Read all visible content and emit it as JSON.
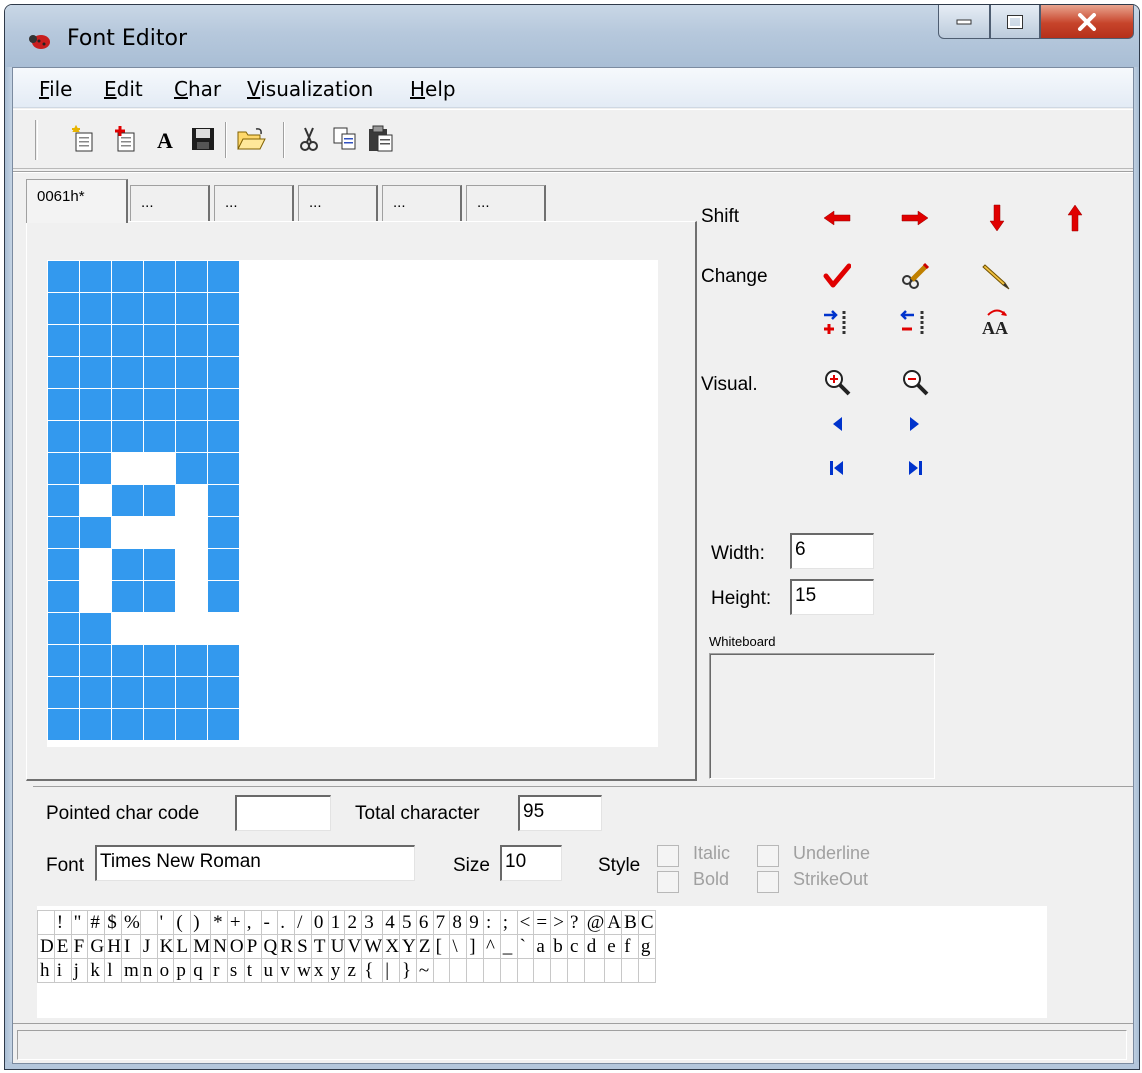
{
  "window": {
    "title": "Font Editor"
  },
  "menu": [
    "File",
    "Edit",
    "Char",
    "Visualization",
    "Help"
  ],
  "menu_underline": [
    "F",
    "E",
    "C",
    "V",
    "H"
  ],
  "toolbar": {
    "icons": [
      "new-font-icon",
      "new-char-icon",
      "font-icon",
      "save-icon",
      "open-icon",
      "cut-icon",
      "copy-icon",
      "paste-icon"
    ]
  },
  "tabs": [
    "0061h*",
    "...",
    "...",
    "...",
    "...",
    "..."
  ],
  "glyph": {
    "cols": 6,
    "rows": 15,
    "on_pixels": [
      [
        6,
        2
      ],
      [
        6,
        3
      ],
      [
        7,
        1
      ],
      [
        7,
        4
      ],
      [
        8,
        2
      ],
      [
        8,
        3
      ],
      [
        8,
        4
      ],
      [
        9,
        1
      ],
      [
        9,
        4
      ],
      [
        10,
        1
      ],
      [
        10,
        4
      ],
      [
        11,
        2
      ],
      [
        11,
        3
      ],
      [
        11,
        4
      ],
      [
        11,
        5
      ]
    ]
  },
  "actions": {
    "shift_label": "Shift",
    "change_label": "Change",
    "visual_label": "Visual.",
    "shift_icons": [
      "shift-left-icon",
      "shift-right-icon",
      "shift-down-icon",
      "shift-up-icon"
    ],
    "change_icons": [
      "check-icon",
      "clear-icon",
      "pencil-icon",
      "insert-column-icon",
      "delete-column-icon",
      "change-case-icon"
    ],
    "visual_icons": [
      "zoom-in-icon",
      "zoom-out-icon",
      "prev-icon",
      "next-icon",
      "first-icon",
      "last-icon"
    ],
    "colors": {
      "red": "#e00000",
      "blue": "#0033cc"
    }
  },
  "dimensions": {
    "width_label": "Width:",
    "width_value": "6",
    "height_label": "Height:",
    "height_value": "15",
    "whiteboard_label": "Whiteboard"
  },
  "info": {
    "pointed_label": "Pointed char code",
    "pointed_value": "",
    "total_label": "Total character",
    "total_value": "95",
    "font_label": "Font",
    "font_value": "Times New Roman",
    "size_label": "Size",
    "size_value": "10",
    "style_label": "Style",
    "italic_label": "Italic",
    "bold_label": "Bold",
    "underline_label": "Underline",
    "strikeout_label": "StrikeOut"
  },
  "char_rows": [
    [
      " ",
      "!",
      "\"",
      "#",
      "$",
      "%",
      "",
      "'",
      "(",
      ")",
      "*",
      "+",
      ",",
      "-",
      ".",
      "/",
      "0",
      "1",
      "2",
      "3",
      "4",
      "5",
      "6",
      "7",
      "8",
      "9",
      ":",
      ";",
      "<",
      "=",
      ">",
      "?",
      "@",
      "A",
      "B",
      "C"
    ],
    [
      "D",
      "E",
      "F",
      "G",
      "H",
      "I",
      "J",
      "K",
      "L",
      "M",
      "N",
      "O",
      "P",
      "Q",
      "R",
      "S",
      "T",
      "U",
      "V",
      "W",
      "X",
      "Y",
      "Z",
      "[",
      "\\",
      "]",
      "^",
      "_",
      "`",
      "a",
      "b",
      "c",
      "d",
      "e",
      "f",
      "g"
    ],
    [
      "h",
      "i",
      "j",
      "k",
      "l",
      "m",
      "n",
      "o",
      "p",
      "q",
      "r",
      "s",
      "t",
      "u",
      "v",
      "w",
      "x",
      "y",
      "z",
      "{",
      "|",
      "}",
      "~",
      "",
      "",
      "",
      "",
      "",
      "",
      "",
      "",
      "",
      "",
      "",
      "",
      ""
    ]
  ]
}
